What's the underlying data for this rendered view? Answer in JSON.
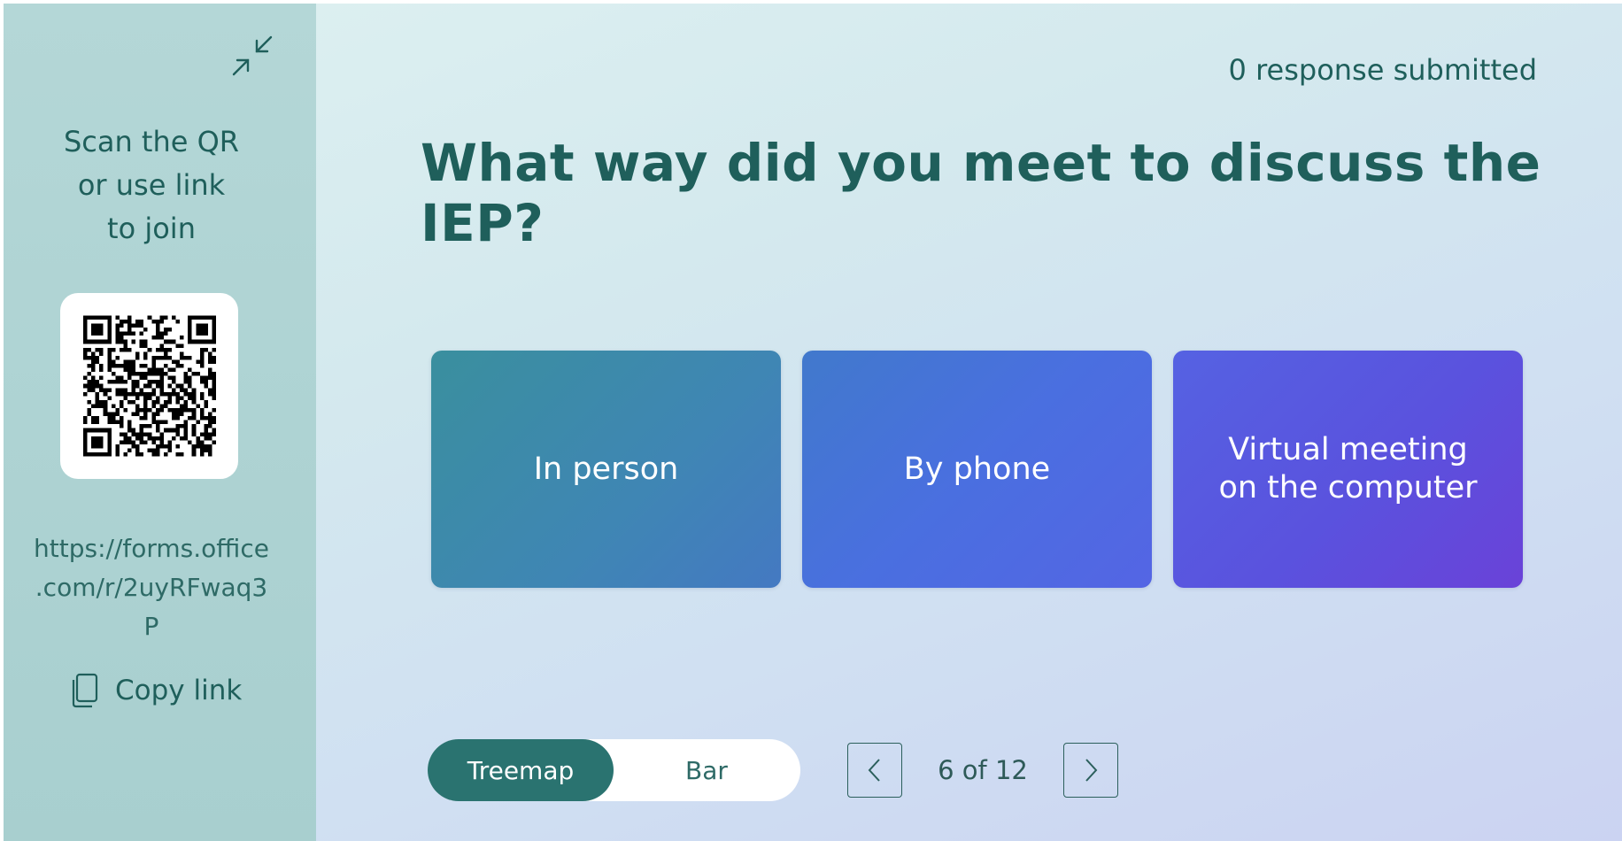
{
  "sidebar": {
    "collapse_icon": "collapse-arrows-icon",
    "join_lines": [
      "Scan the QR",
      "or use link",
      "to join"
    ],
    "link_text": "https://forms.office\n.com/r/2uyRFwaq3\nP",
    "copy_label": "Copy link",
    "copy_icon": "copy-icon"
  },
  "header": {
    "response_count": "0 response submitted"
  },
  "question": {
    "title": "What way did you meet to discuss the IEP?"
  },
  "options": [
    {
      "label": "In person"
    },
    {
      "label": "By phone"
    },
    {
      "label": "Virtual meeting on the computer"
    }
  ],
  "view_toggle": {
    "options": [
      "Treemap",
      "Bar"
    ],
    "selected": "Treemap"
  },
  "pager": {
    "indicator": "6 of 12",
    "prev_icon": "chevron-left-icon",
    "next_icon": "chevron-right-icon"
  },
  "colors": {
    "text_primary": "#1f5f5b",
    "accent": "#2a7370"
  }
}
